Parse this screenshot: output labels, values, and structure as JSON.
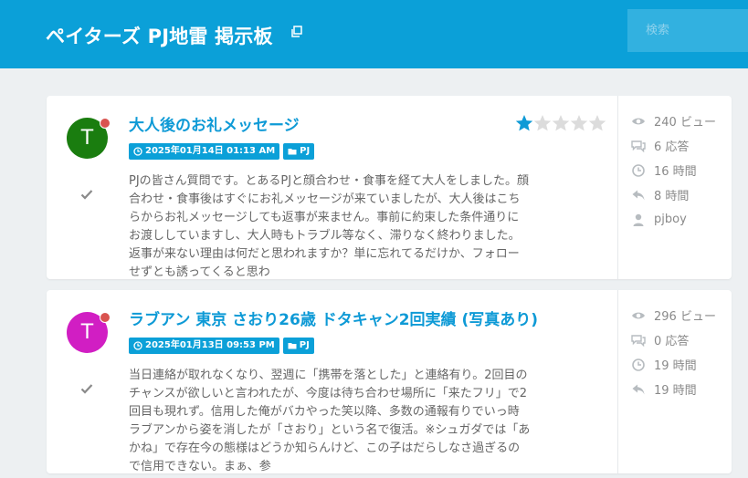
{
  "header": {
    "title": "ペイターズ PJ地雷 掲示板",
    "search_placeholder": "検索"
  },
  "posts": [
    {
      "avatar_letter": "T",
      "avatar_color": "#1a7d0f",
      "title": "大人後のお礼メッセージ",
      "rating": 1,
      "rating_max": 5,
      "date": "2025年01月14日 01:13 AM",
      "category": "PJ",
      "excerpt": "PJの皆さん質問です。とあるPJと顔合わせ・食事を経て大人をしました。顔合わせ・食事後はすぐにお礼メッセージが来ていましたが、大人後はこちらからお礼メッセージしても返事が来ません。事前に約束した条件通りにお渡ししていますし、大人時もトラブル等なく、滞りなく終わりました。返事が来ない理由は何だと思われますか？単に忘れてるだけか、フォローせずとも誘ってくると思わ",
      "views": "240 ビュー",
      "replies": "6 応答",
      "activity": "16 時間",
      "last_reply": "8 時間",
      "author": "pjboy"
    },
    {
      "avatar_letter": "T",
      "avatar_color": "#d11ec3",
      "title": "ラブアン 東京 さおり26歳 ドタキャン2回実績 (写真あり)",
      "rating": 0,
      "rating_max": 5,
      "date": "2025年01月13日 09:53 PM",
      "category": "PJ",
      "excerpt": "当日連絡が取れなくなり、翌週に「携帯を落とした」と連絡有り。2回目のチャンスが欲しいと言われたが、今度は待ち合わせ場所に「来たフリ」で2回目も現れず。信用した俺がバカやった笑以降、多数の通報有りでいっ時ラブアンから姿を消したが「さおり」という名で復活。※シュガダでは「あかね」で存在今の態様はどうか知らんけど、この子はだらしなさ過ぎるので信用できない。まぁ、参",
      "views": "296 ビュー",
      "replies": "0 応答",
      "activity": "19 時間",
      "last_reply": "19 時間",
      "author": ""
    }
  ],
  "colors": {
    "accent": "#0ba0d8",
    "star_on": "#0e9ad6",
    "star_off": "#dcdcdc",
    "meta_icon": "#b7bcc0"
  }
}
